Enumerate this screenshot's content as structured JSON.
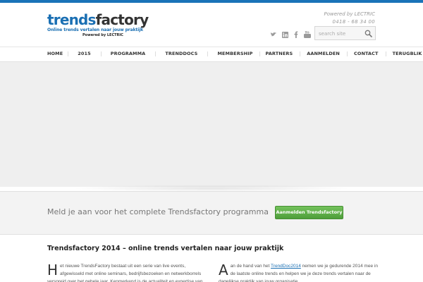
{
  "logo": {
    "word_part1": "trends",
    "word_part2": "factory",
    "tagline": "Online trends vertalen naar jouw praktijk",
    "powered": "Powered by LECTRIC"
  },
  "header": {
    "powered_by": "Powered by LECTRIC",
    "phone": "0418 - 68 34 00"
  },
  "socials": [
    "twitter-icon",
    "linkedin-icon",
    "facebook-icon",
    "youtube-icon"
  ],
  "search": {
    "placeholder": "search site"
  },
  "nav": {
    "items": [
      {
        "label": "HOME"
      },
      {
        "label": "2015"
      },
      {
        "label": "PROGRAMMA"
      },
      {
        "label": "TRENDDOCS"
      },
      {
        "label": "MEMBERSHIP"
      },
      {
        "label": "PARTNERS"
      },
      {
        "label": "AANMELDEN"
      },
      {
        "label": "CONTACT"
      },
      {
        "label": "TERUGBLIK"
      }
    ]
  },
  "cta": {
    "text": "Meld je aan voor het complete Trendsfactory programma",
    "button_label": "Aanmelden Trendsfactory"
  },
  "content": {
    "title": "Trendsfactory 2014 – online trends vertalen naar jouw praktijk",
    "col1": {
      "dropcap": "H",
      "text": "et nieuwe TrendsFactory bestaat uit een serie van live events, afgewisseld met online seminars, bedrijfsbezoeken en netwerkborrels verspreid over het gehele jaar. Kenmerkend is de actualiteit en expertise van"
    },
    "col2": {
      "dropcap": "A",
      "text_before": "an de hand van het ",
      "link": "TrendDoc2014",
      "text_after": " nemen we je gedurende 2014 mee in de laatste online trends en helpen we je deze trends vertalen naar de dagelijkse praktijk van jouw organisatie."
    }
  },
  "colors": {
    "brand_blue": "#1a6fb3",
    "cta_green": "#5aa843"
  }
}
